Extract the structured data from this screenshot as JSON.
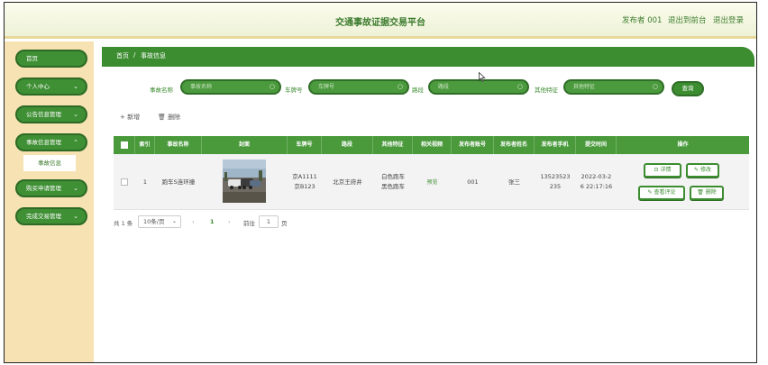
{
  "header": {
    "title": "交通事故证据交易平台",
    "user": "发布者 001",
    "back_link": "退出到前台",
    "logout_link": "退出登录"
  },
  "sidebar": {
    "items": [
      {
        "label": "首页",
        "chevron": ""
      },
      {
        "label": "个人中心",
        "chevron": "⌄"
      },
      {
        "label": "公告信息管理",
        "chevron": "⌄"
      },
      {
        "label": "事故信息管理",
        "chevron": "⌃"
      },
      {
        "label": "购买申请管理",
        "chevron": "⌄"
      },
      {
        "label": "完成交易管理",
        "chevron": "⌄"
      }
    ],
    "submenu": "事故信息"
  },
  "breadcrumb": {
    "home": "首页",
    "sep": "/",
    "current": "事故信息"
  },
  "search": {
    "fields": [
      {
        "label": "事故名称",
        "placeholder": "事故名称"
      },
      {
        "label": "车牌号",
        "placeholder": "车牌号"
      },
      {
        "label": "路段",
        "placeholder": "路段"
      },
      {
        "label": "其他特征",
        "placeholder": "其他特征"
      }
    ],
    "query_label": "查询"
  },
  "toolbar": {
    "add_label": "+ 新增",
    "delete_label": "🗑 删除"
  },
  "table": {
    "headers": [
      "索引",
      "事故名称",
      "封面",
      "车牌号",
      "路段",
      "其他特征",
      "相关视频",
      "发布者账号",
      "发布者姓名",
      "发布者手机",
      "提交时间",
      "操作"
    ],
    "rows": [
      {
        "index": "1",
        "name": "跑车S连环撞",
        "plate_1": "京A1111",
        "plate_2": "京B123",
        "road": "北京王府井",
        "feature_1": "白色跑车",
        "feature_2": "黑色跑车",
        "video": "预览",
        "account": "001",
        "publisher": "张三",
        "phone_1": "13523523",
        "phone_2": "235",
        "time_1": "2022-03-2",
        "time_2": "6 22:17:16",
        "actions": {
          "detail": "详情",
          "edit": "修改",
          "comment": "查看评论",
          "delete": "删除"
        }
      }
    ]
  },
  "pagination": {
    "total": "共 1 条",
    "page_size": "10条/页",
    "current": "1",
    "goto_label": "前往",
    "goto_value": "1",
    "page_suffix": "页"
  },
  "colors": {
    "primary": "#3c8c30",
    "sidebar": "#f7e2b4",
    "header": "#f3f6e2"
  }
}
